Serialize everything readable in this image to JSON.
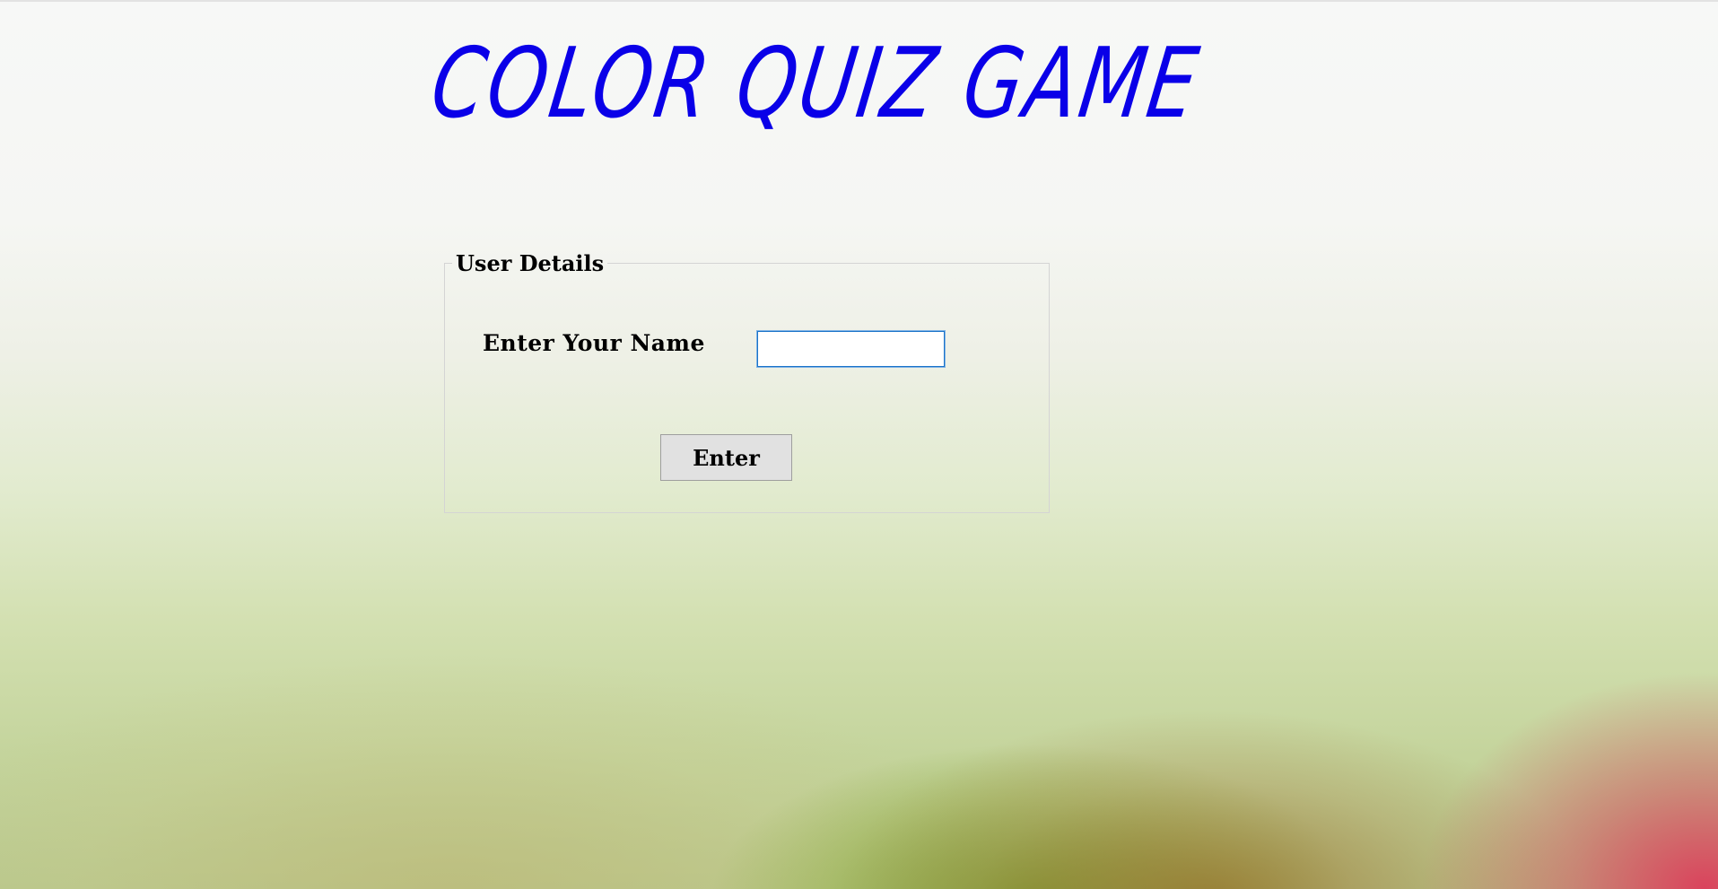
{
  "app": {
    "title": "COLOR QUIZ GAME"
  },
  "form": {
    "legend": "User Details",
    "name_label": "Enter Your Name",
    "name_value": "",
    "submit_label": "Enter"
  },
  "colors": {
    "title": "#0a00e8",
    "input_focus_border": "#1a73c8",
    "button_background": "#e1e1e1"
  }
}
